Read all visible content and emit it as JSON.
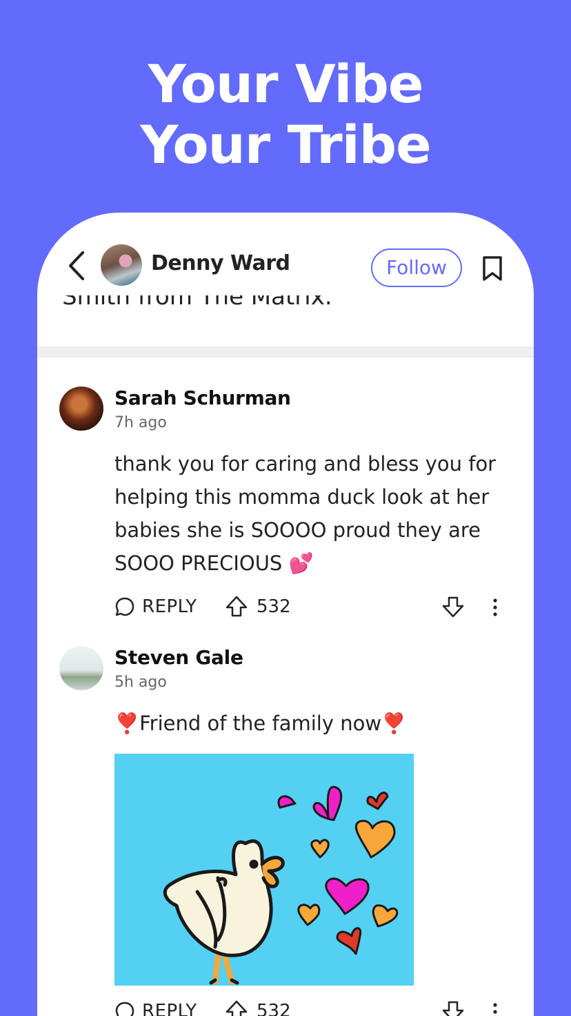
{
  "headline": {
    "line1": "Your Vibe",
    "line2": "Your Tribe"
  },
  "topbar": {
    "author_name": "Denny Ward",
    "follow_label": "Follow"
  },
  "post": {
    "cut_off_text": "Smith from The Matrix."
  },
  "comments": [
    {
      "author": "Sarah Schurman",
      "time": "7h ago",
      "text": "thank you for caring and bless you for helping this momma duck look at her babies she is SOOOO proud they are SOOO PRECIOUS 💕",
      "reply_label": "REPLY",
      "votes": "532"
    },
    {
      "author": "Steven Gale",
      "time": "5h ago",
      "text": "❣️Friend of the family now❣️",
      "reply_label": "REPLY",
      "votes": "532"
    }
  ],
  "colors": {
    "brand": "#636bfc",
    "image_bg": "#54d0f3"
  },
  "icons": [
    "back-arrow-icon",
    "bookmark-icon",
    "reply-bubble-icon",
    "upvote-arrow-icon",
    "downvote-arrow-icon",
    "more-options-icon"
  ]
}
